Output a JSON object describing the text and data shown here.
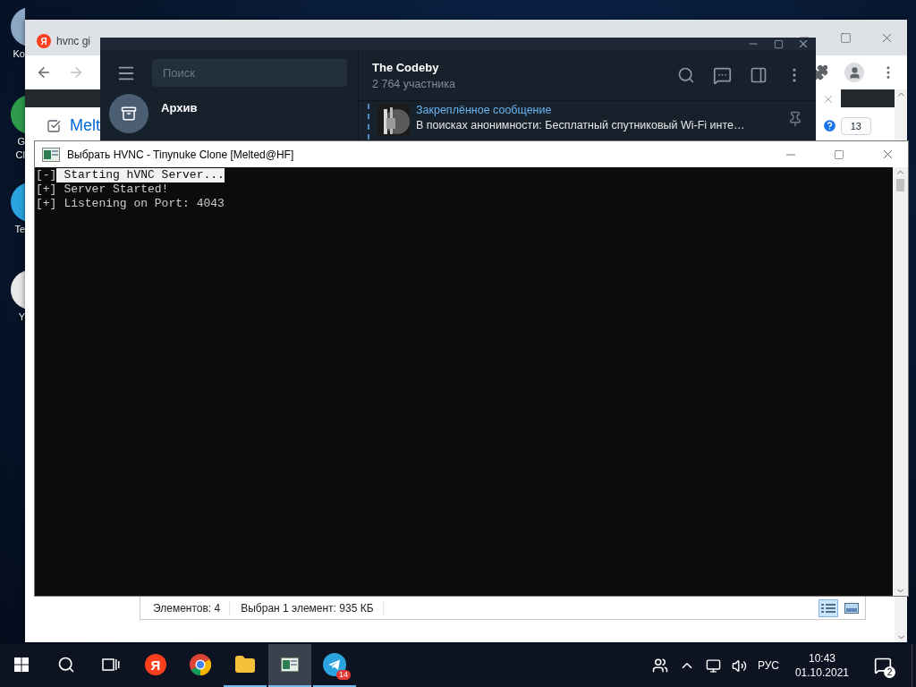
{
  "desktop_icons": [
    {
      "kind": "bin",
      "label_lines": [
        "Ko"
      ]
    },
    {
      "kind": "chrome",
      "label_lines": [
        "G",
        "Cl"
      ]
    },
    {
      "kind": "telegram",
      "label_lines": [
        "Te"
      ]
    },
    {
      "kind": "yandex",
      "label_lines": [
        "Y"
      ]
    }
  ],
  "browser": {
    "tabs": [
      {
        "favicon": "Я",
        "label": "hvnc gi",
        "selected": false
      }
    ],
    "page": {
      "link": "Melt",
      "count": "13"
    }
  },
  "explorer": {
    "status": [
      "Элементов: 4",
      "Выбран 1 элемент: 935 КБ"
    ],
    "views": [
      {
        "kind": "details",
        "selected": true
      },
      {
        "kind": "tiles",
        "selected": false
      }
    ]
  },
  "telegram": {
    "search": {
      "placeholder": "Поиск"
    },
    "chats": [
      {
        "kind": "archive",
        "name": "Архив"
      }
    ],
    "chat": {
      "title": "The Codeby",
      "subtitle": "2 764 участника"
    },
    "pinned": {
      "title": "Закреплённое сообщение",
      "text": "В поисках анонимности: Бесплатный спутниковый Wi-Fi инте…"
    }
  },
  "console": {
    "title": "Выбрать HVNC - Tinynuke Clone [Melted@HF]",
    "lines": [
      {
        "prefix": "[-]",
        "text": "Starting hVNC Server...",
        "selected": true
      },
      {
        "prefix": "[+]",
        "text": "Server Started!",
        "selected": false
      },
      {
        "prefix": "[+]",
        "text": "Listening on Port: 4043",
        "selected": false
      }
    ]
  },
  "taskbar": {
    "apps": [
      {
        "kind": "yandex",
        "label": "Я",
        "running": false,
        "selected": false
      },
      {
        "kind": "chrome",
        "running": false,
        "selected": false
      },
      {
        "kind": "explorer",
        "running": true,
        "selected": false
      },
      {
        "kind": "console",
        "running": true,
        "selected": true
      },
      {
        "kind": "telegram",
        "running": true,
        "selected": false,
        "badge": "14"
      }
    ],
    "tray": {
      "language": "РУС",
      "time": "10:43",
      "date": "01.10.2021",
      "notifications": "2"
    }
  }
}
